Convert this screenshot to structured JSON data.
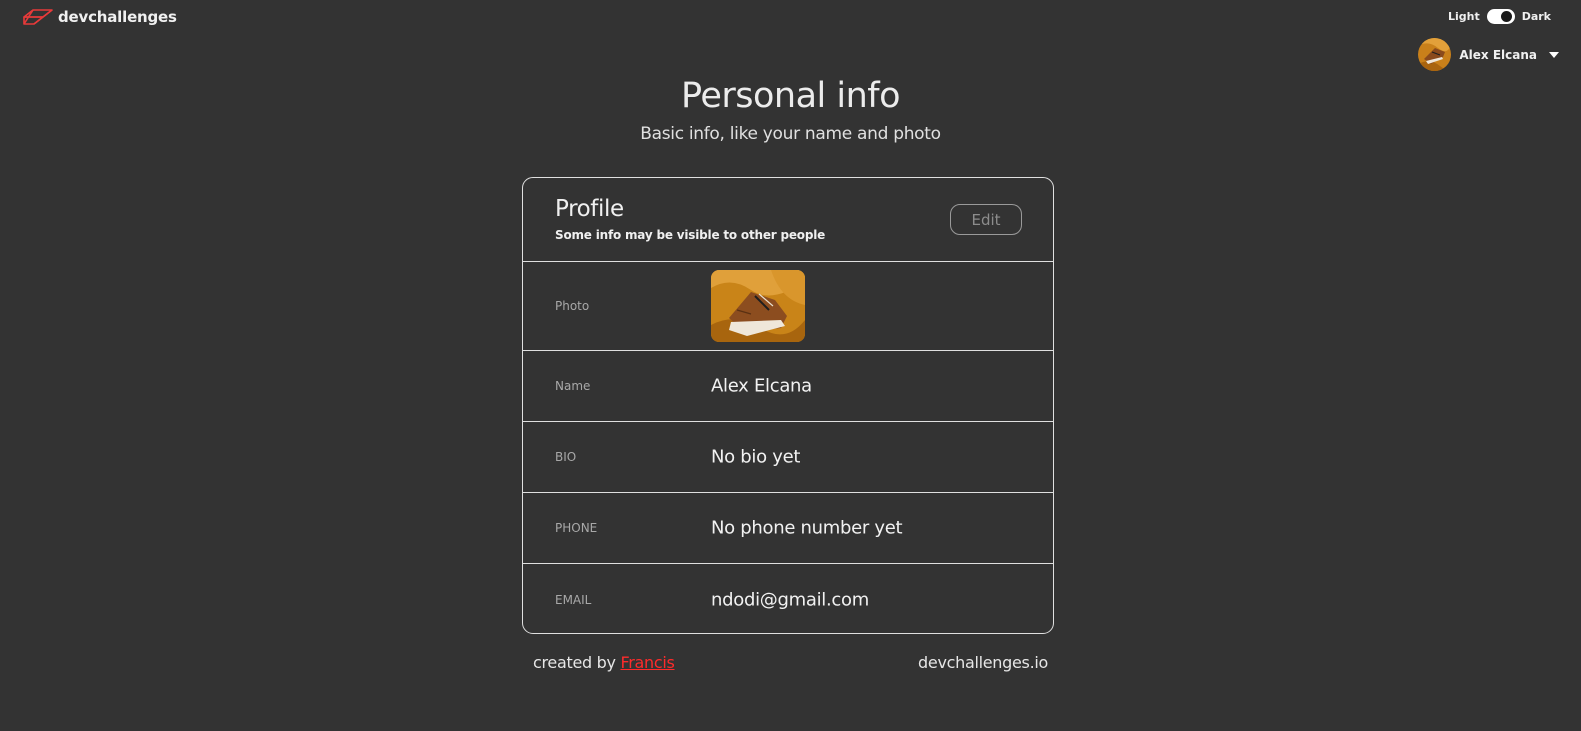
{
  "header": {
    "brand": "devchallenges",
    "theme": {
      "light_label": "Light",
      "dark_label": "Dark",
      "mode": "dark"
    },
    "user": {
      "name": "Alex Elcana"
    }
  },
  "page": {
    "title": "Personal info",
    "subtitle": "Basic info, like your name and photo"
  },
  "profile": {
    "title": "Profile",
    "description": "Some info may be visible to other people",
    "edit_label": "Edit",
    "rows": [
      {
        "label": "Photo"
      },
      {
        "label": "Name",
        "value": "Alex Elcana"
      },
      {
        "label": "BIO",
        "value": "No bio yet"
      },
      {
        "label": "PHONE",
        "value": "No phone number yet"
      },
      {
        "label": "EMAIL",
        "value": "ndodi@gmail.com"
      }
    ]
  },
  "footer": {
    "created_by": "created by",
    "author": "Francis",
    "site": "devchallenges.io"
  },
  "colors": {
    "background": "#333333",
    "accent_red": "#ff2b2b",
    "border": "#e0e0e0",
    "photo_orange": "#d48a1e"
  }
}
